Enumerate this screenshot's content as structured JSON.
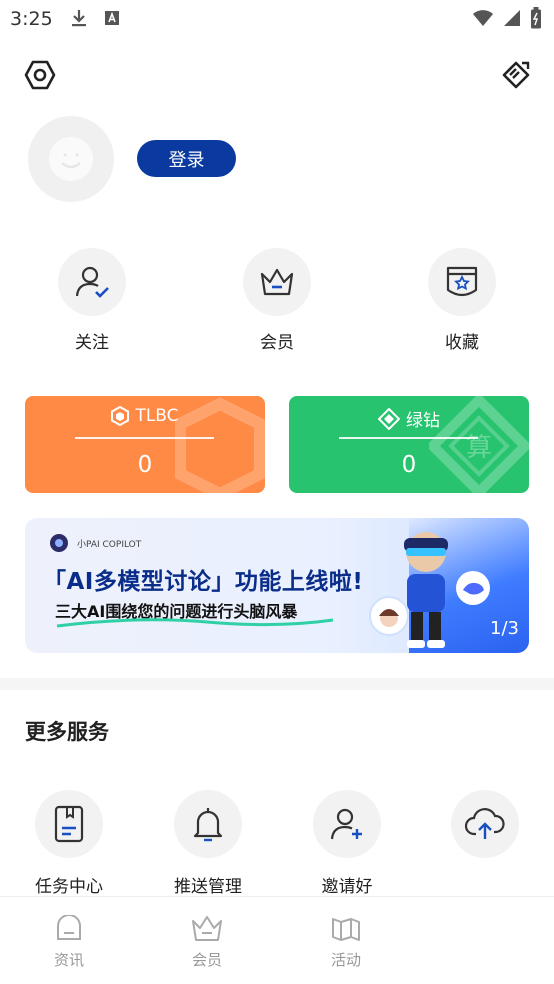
{
  "status_bar": {
    "time": "3:25"
  },
  "profile": {
    "login_label": "登录"
  },
  "quick_actions": [
    {
      "label": "关注",
      "icon": "user-check-icon"
    },
    {
      "label": "会员",
      "icon": "crown-icon"
    },
    {
      "label": "收藏",
      "icon": "favorite-star-icon"
    }
  ],
  "cards": [
    {
      "title": "TLBC",
      "value": "0",
      "color": "#ff8a45",
      "icon": "hexagon-token-icon"
    },
    {
      "title": "绿钻",
      "value": "0",
      "color": "#27c36f",
      "icon": "diamond-icon"
    }
  ],
  "banner": {
    "brand": "小PAI COPILOT",
    "headline": "「AI多模型讨论」功能上线啦!",
    "subline": "三大AI围绕您的问题进行头脑风暴",
    "page_indicator": "1/3"
  },
  "services": {
    "title": "更多服务",
    "items": [
      {
        "label": "任务中心",
        "icon": "task-book-icon"
      },
      {
        "label": "推送管理",
        "icon": "bell-icon"
      },
      {
        "label": "邀请好",
        "icon": "add-user-icon"
      },
      {
        "label": "",
        "icon": "cloud-upload-icon"
      }
    ]
  },
  "tabbar": {
    "items": [
      {
        "label": "资讯",
        "icon": "news-icon"
      },
      {
        "label": "会员",
        "icon": "crown-icon"
      },
      {
        "label": "活动",
        "icon": "map-book-icon"
      }
    ]
  },
  "colors": {
    "primary": "#0a3aa0",
    "orange": "#ff8a45",
    "green": "#27c36f"
  }
}
